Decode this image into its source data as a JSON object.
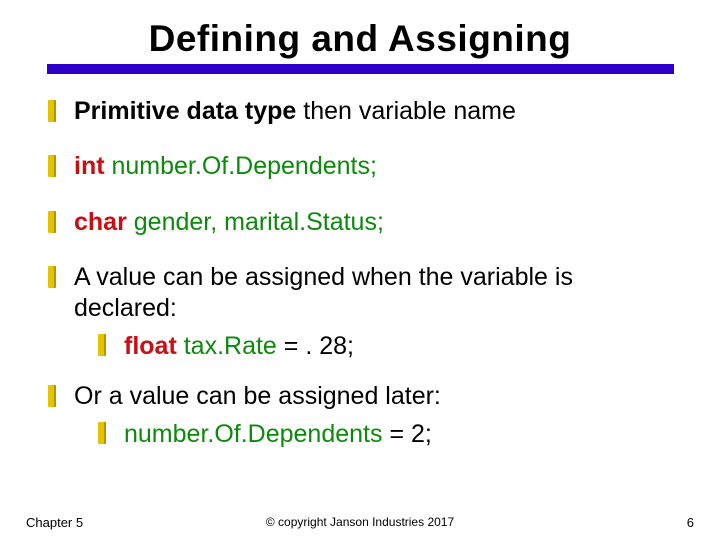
{
  "title": "Defining and Assigning",
  "bullets": {
    "b1_bold": "Primitive data type",
    "b1_rest": " then variable name",
    "b2_kw": "int",
    "b2_rest": "  number.Of.Dependents;",
    "b3_kw": "char",
    "b3_rest": "  gender, marital.Status;",
    "b4": "A value can be assigned when the variable is declared:",
    "b4_sub_kw": "float",
    "b4_sub_var": "  tax.Rate ",
    "b4_sub_eq": "= . 28;",
    "b5": "Or a value can be assigned later:",
    "b5_sub_var": "number.Of.Dependents ",
    "b5_sub_eq": "= 2;"
  },
  "footer": {
    "left": "Chapter 5",
    "center": "© copyright Janson Industries 2017",
    "right": "6"
  }
}
